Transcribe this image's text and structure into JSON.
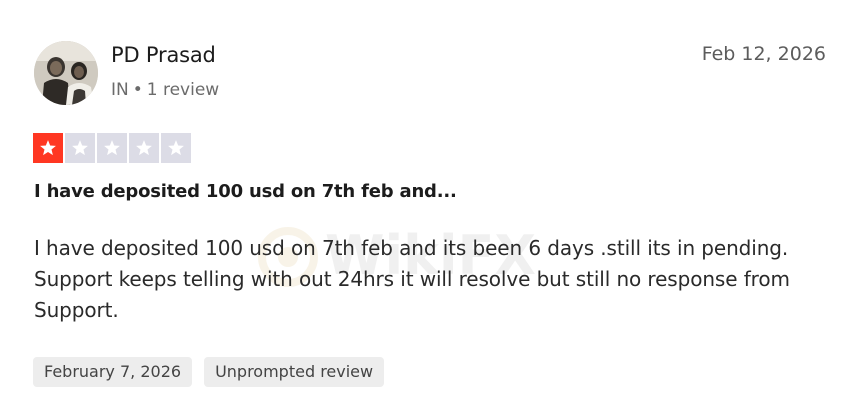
{
  "reviewer": {
    "name": "PD Prasad",
    "country": "IN",
    "separator": "•",
    "review_count": "1 review"
  },
  "review": {
    "date": "Feb 12, 2026",
    "rating": 1,
    "rating_max": 5,
    "title": "I have deposited 100 usd on 7th feb and...",
    "body": "I have deposited 100 usd on 7th feb and its been 6 days .still its in pending. Support keeps telling with out 24hrs it will resolve but still no response from Support."
  },
  "tags": {
    "experience_date": "February 7, 2026",
    "review_type": "Unprompted review"
  },
  "watermark": {
    "text": "WikiFX"
  },
  "colors": {
    "star_filled": "#ff3722",
    "star_empty": "#dcdce6",
    "tag_bg": "#ededed"
  }
}
